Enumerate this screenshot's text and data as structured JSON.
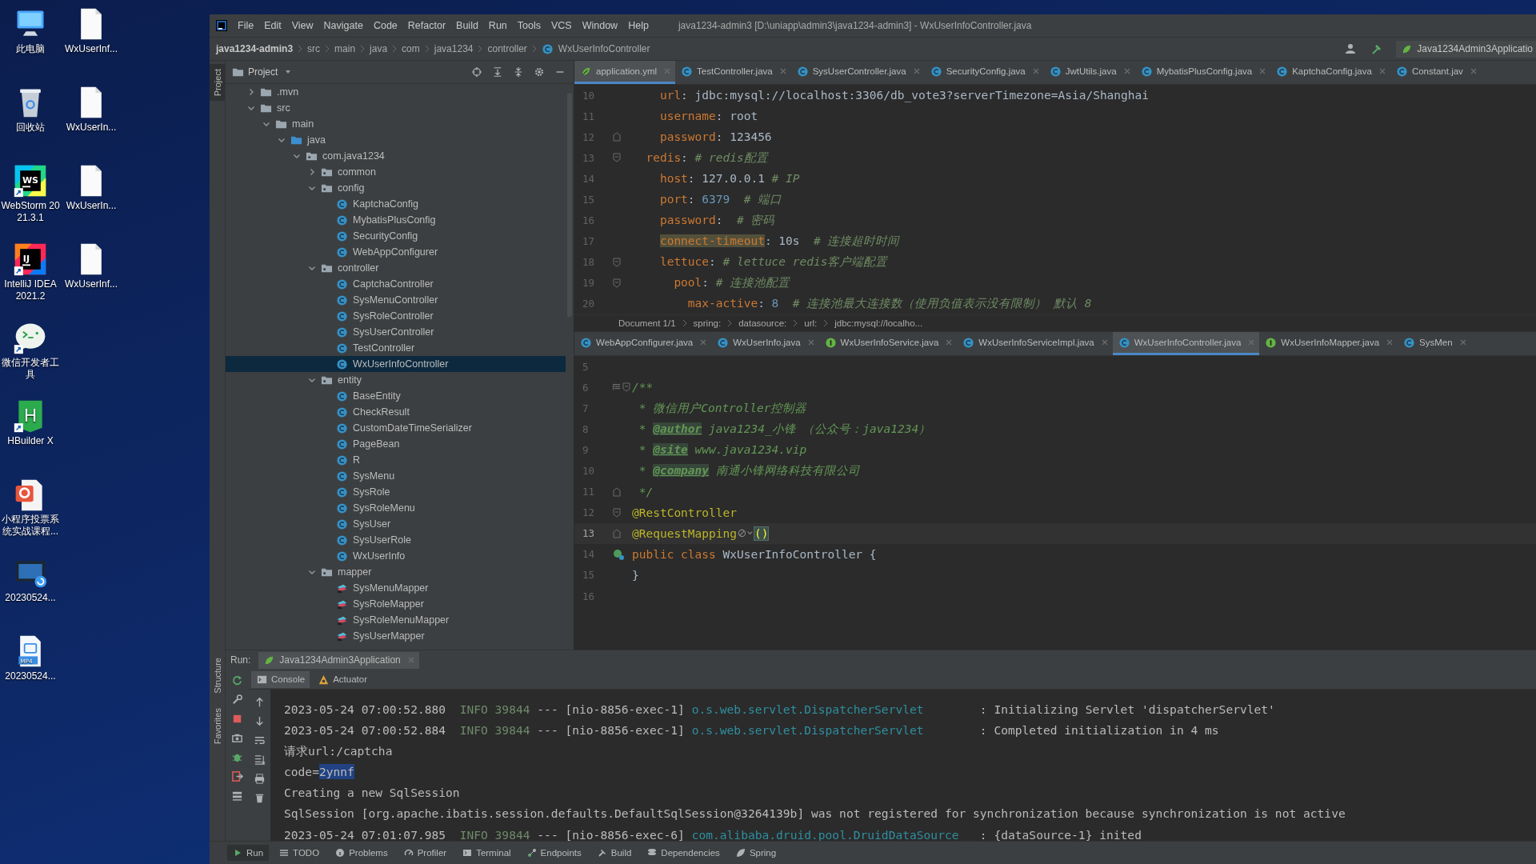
{
  "desktop": {
    "icon_columns": [
      {
        "icons": [
          {
            "label": "此电脑",
            "kind": "computer",
            "shortcut": false
          },
          {
            "label": "回收站",
            "kind": "recycle-bin",
            "shortcut": false
          },
          {
            "label": "WebStorm 2021.3.1",
            "kind": "webstorm",
            "badge": "WS",
            "shortcut": true
          },
          {
            "label": "IntelliJ IDEA 2021.2",
            "kind": "intellij",
            "badge": "IJ",
            "shortcut": true
          },
          {
            "label": "微信开发者工具",
            "kind": "wechat-devtool",
            "shortcut": true
          },
          {
            "label": "HBuilder X",
            "kind": "hbuilder",
            "badge": "H",
            "shortcut": true
          },
          {
            "label": "小程序投票系统实战课程...",
            "kind": "ppt",
            "shortcut": false
          },
          {
            "label": "20230524...",
            "kind": "video",
            "shortcut": false
          },
          {
            "label": "20230524...",
            "kind": "mp4",
            "badge": "MP4",
            "shortcut": false
          }
        ]
      },
      {
        "icons": [
          {
            "label": "WxUserInf...",
            "kind": "file",
            "shortcut": false
          },
          {
            "label": "WxUserIn...",
            "kind": "file",
            "shortcut": false
          },
          {
            "label": "WxUserIn...",
            "kind": "file",
            "shortcut": false
          },
          {
            "label": "WxUserInf...",
            "kind": "file",
            "shortcut": false
          }
        ]
      }
    ]
  },
  "ide": {
    "menu": [
      "File",
      "Edit",
      "View",
      "Navigate",
      "Code",
      "Refactor",
      "Build",
      "Run",
      "Tools",
      "VCS",
      "Window",
      "Help"
    ],
    "title": "java1234-admin3 [D:\\uniapp\\admin3\\java1234-admin3] - WxUserInfoController.java",
    "breadcrumb": [
      "java1234-admin3",
      "src",
      "main",
      "java",
      "com",
      "java1234",
      "controller",
      "WxUserInfoController"
    ],
    "run_config": "Java1234Admin3Applicatio",
    "project_strip": "Project",
    "project": {
      "title": "Project",
      "tree": [
        {
          "label": ".mvn",
          "kind": "folder",
          "expanded": false,
          "selected": false
        },
        {
          "label": "src",
          "kind": "folder",
          "expanded": true,
          "selected": false,
          "children": [
            {
              "label": "main",
              "kind": "folder",
              "expanded": true,
              "selected": false,
              "children": [
                {
                  "label": "java",
                  "kind": "source-folder",
                  "expanded": true,
                  "selected": false,
                  "children": [
                    {
                      "label": "com.java1234",
                      "kind": "package",
                      "expanded": true,
                      "selected": false,
                      "children": [
                        {
                          "label": "common",
                          "kind": "package",
                          "expanded": false,
                          "selected": false
                        },
                        {
                          "label": "config",
                          "kind": "package",
                          "expanded": true,
                          "selected": false,
                          "children": [
                            {
                              "label": "KaptchaConfig",
                              "kind": "class",
                              "selected": false
                            },
                            {
                              "label": "MybatisPlusConfig",
                              "kind": "class",
                              "selected": false
                            },
                            {
                              "label": "SecurityConfig",
                              "kind": "class",
                              "selected": false
                            },
                            {
                              "label": "WebAppConfigurer",
                              "kind": "class",
                              "selected": false
                            }
                          ]
                        },
                        {
                          "label": "controller",
                          "kind": "package",
                          "expanded": true,
                          "selected": false,
                          "children": [
                            {
                              "label": "CaptchaController",
                              "kind": "class",
                              "selected": false
                            },
                            {
                              "label": "SysMenuController",
                              "kind": "class",
                              "selected": false
                            },
                            {
                              "label": "SysRoleController",
                              "kind": "class",
                              "selected": false
                            },
                            {
                              "label": "SysUserController",
                              "kind": "class",
                              "selected": false
                            },
                            {
                              "label": "TestController",
                              "kind": "class",
                              "selected": false
                            },
                            {
                              "label": "WxUserInfoController",
                              "kind": "class",
                              "selected": true
                            }
                          ]
                        },
                        {
                          "label": "entity",
                          "kind": "package",
                          "expanded": true,
                          "selected": false,
                          "children": [
                            {
                              "label": "BaseEntity",
                              "kind": "class",
                              "selected": false
                            },
                            {
                              "label": "CheckResult",
                              "kind": "class",
                              "selected": false
                            },
                            {
                              "label": "CustomDateTimeSerializer",
                              "kind": "class",
                              "selected": false
                            },
                            {
                              "label": "PageBean",
                              "kind": "class",
                              "selected": false
                            },
                            {
                              "label": "R",
                              "kind": "class",
                              "selected": false
                            },
                            {
                              "label": "SysMenu",
                              "kind": "class",
                              "selected": false
                            },
                            {
                              "label": "SysRole",
                              "kind": "class",
                              "selected": false
                            },
                            {
                              "label": "SysRoleMenu",
                              "kind": "class",
                              "selected": false
                            },
                            {
                              "label": "SysUser",
                              "kind": "class",
                              "selected": false
                            },
                            {
                              "label": "SysUserRole",
                              "kind": "class",
                              "selected": false
                            },
                            {
                              "label": "WxUserInfo",
                              "kind": "class",
                              "selected": false
                            }
                          ]
                        },
                        {
                          "label": "mapper",
                          "kind": "package",
                          "expanded": true,
                          "selected": false,
                          "children": [
                            {
                              "label": "SysMenuMapper",
                              "kind": "mapper",
                              "selected": false
                            },
                            {
                              "label": "SysRoleMapper",
                              "kind": "mapper",
                              "selected": false
                            },
                            {
                              "label": "SysRoleMenuMapper",
                              "kind": "mapper",
                              "selected": false
                            },
                            {
                              "label": "SysUserMapper",
                              "kind": "mapper",
                              "selected": false
                            }
                          ]
                        }
                      ]
                    }
                  ]
                }
              ]
            }
          ]
        }
      ]
    },
    "top_editor": {
      "tabs": [
        {
          "label": "application.yml",
          "kind": "yaml",
          "selected": true
        },
        {
          "label": "TestController.java",
          "kind": "class",
          "selected": false
        },
        {
          "label": "SysUserController.java",
          "kind": "class",
          "selected": false
        },
        {
          "label": "SecurityConfig.java",
          "kind": "class",
          "selected": false
        },
        {
          "label": "JwtUtils.java",
          "kind": "class",
          "selected": false
        },
        {
          "label": "MybatisPlusConfig.java",
          "kind": "class",
          "selected": false
        },
        {
          "label": "KaptchaConfig.java",
          "kind": "class",
          "selected": false
        },
        {
          "label": "Constant.jav",
          "kind": "class",
          "selected": false
        }
      ],
      "lines": [
        {
          "number": "10",
          "kind": "plain",
          "tokens": [
            {
              "text": "    url",
              "kind": "key"
            },
            {
              "text": ": jdbc:mysql://localhost:3306/db_vote3?serverTimezone=Asia/Shanghai",
              "kind": "plain"
            }
          ]
        },
        {
          "number": "11",
          "kind": "plain",
          "tokens": [
            {
              "text": "    username",
              "kind": "key"
            },
            {
              "text": ": root",
              "kind": "plain"
            }
          ]
        },
        {
          "number": "12",
          "kind": "fold-end",
          "tokens": [
            {
              "text": "    password",
              "kind": "key"
            },
            {
              "text": ": 123456",
              "kind": "plain"
            }
          ]
        },
        {
          "number": "13",
          "kind": "fold-start",
          "tokens": [
            {
              "text": "  redis",
              "kind": "key"
            },
            {
              "text": ": ",
              "kind": "plain"
            },
            {
              "text": "# redis配置",
              "kind": "comment"
            }
          ]
        },
        {
          "number": "14",
          "kind": "plain",
          "tokens": [
            {
              "text": "    host",
              "kind": "key"
            },
            {
              "text": ": 127.0.0.1 ",
              "kind": "plain"
            },
            {
              "text": "# IP",
              "kind": "comment"
            }
          ]
        },
        {
          "number": "15",
          "kind": "plain",
          "tokens": [
            {
              "text": "    port",
              "kind": "key"
            },
            {
              "text": ": ",
              "kind": "plain"
            },
            {
              "text": "6379",
              "kind": "number"
            },
            {
              "text": "  # 端口",
              "kind": "comment"
            }
          ]
        },
        {
          "number": "16",
          "kind": "plain",
          "tokens": [
            {
              "text": "    password",
              "kind": "key"
            },
            {
              "text": ":  ",
              "kind": "plain"
            },
            {
              "text": "# 密码",
              "kind": "comment"
            }
          ]
        },
        {
          "number": "17",
          "kind": "plain",
          "tokens": [
            {
              "text": "    connect-timeout",
              "kind": "key-highlight"
            },
            {
              "text": ": 10s  ",
              "kind": "plain"
            },
            {
              "text": "# 连接超时时间",
              "kind": "comment"
            }
          ]
        },
        {
          "number": "18",
          "kind": "fold-start",
          "tokens": [
            {
              "text": "    lettuce",
              "kind": "key"
            },
            {
              "text": ": ",
              "kind": "plain"
            },
            {
              "text": "# lettuce redis客户端配置",
              "kind": "comment"
            }
          ]
        },
        {
          "number": "19",
          "kind": "fold-start",
          "tokens": [
            {
              "text": "      pool",
              "kind": "key"
            },
            {
              "text": ": ",
              "kind": "plain"
            },
            {
              "text": "# 连接池配置",
              "kind": "comment"
            }
          ]
        },
        {
          "number": "20",
          "kind": "plain",
          "tokens": [
            {
              "text": "        max-active",
              "kind": "key"
            },
            {
              "text": ": ",
              "kind": "plain"
            },
            {
              "text": "8",
              "kind": "number"
            },
            {
              "text": "  # 连接池最大连接数（使用负值表示没有限制） 默认 8",
              "kind": "comment"
            }
          ]
        }
      ],
      "breadcrumb": [
        "Document 1/1",
        "spring:",
        "datasource:",
        "url:",
        "jdbc:mysql://localho..."
      ]
    },
    "bottom_editor": {
      "tabs": [
        {
          "label": "WebAppConfigurer.java",
          "kind": "class",
          "selected": false
        },
        {
          "label": "WxUserInfo.java",
          "kind": "class",
          "selected": false
        },
        {
          "label": "WxUserInfoService.java",
          "kind": "interface",
          "selected": false
        },
        {
          "label": "WxUserInfoServiceImpl.java",
          "kind": "class",
          "selected": false
        },
        {
          "label": "WxUserInfoController.java",
          "kind": "class",
          "selected": true
        },
        {
          "label": "WxUserInfoMapper.java",
          "kind": "interface",
          "selected": false
        },
        {
          "label": "SysMen",
          "kind": "class",
          "selected": false
        }
      ],
      "lines": [
        {
          "number": "5",
          "current": false,
          "kind": "plain"
        },
        {
          "number": "6",
          "current": false,
          "kind": "doc-fold",
          "tokens": [
            {
              "text": "/**",
              "kind": "doc"
            }
          ]
        },
        {
          "number": "7",
          "current": false,
          "kind": "plain",
          "tokens": [
            {
              "text": " * 微信用户Controller控制器",
              "kind": "doc"
            }
          ]
        },
        {
          "number": "8",
          "current": false,
          "kind": "plain",
          "tokens": [
            {
              "text": " * ",
              "kind": "doc"
            },
            {
              "text": "@author",
              "kind": "doc-tag"
            },
            {
              "text": " java1234_小锋 （公众号：java1234）",
              "kind": "doc"
            }
          ]
        },
        {
          "number": "9",
          "current": false,
          "kind": "plain",
          "tokens": [
            {
              "text": " * ",
              "kind": "doc"
            },
            {
              "text": "@site",
              "kind": "doc-tag"
            },
            {
              "text": " www.java1234.vip",
              "kind": "doc"
            }
          ]
        },
        {
          "number": "10",
          "current": false,
          "kind": "plain",
          "tokens": [
            {
              "text": " * ",
              "kind": "doc"
            },
            {
              "text": "@company",
              "kind": "doc-tag"
            },
            {
              "text": " 南通小锋网络科技有限公司",
              "kind": "doc"
            }
          ]
        },
        {
          "number": "11",
          "current": false,
          "kind": "fold-end",
          "tokens": [
            {
              "text": " */",
              "kind": "doc"
            }
          ]
        },
        {
          "number": "12",
          "current": false,
          "kind": "fold-start",
          "tokens": [
            {
              "text": "@RestController",
              "kind": "annotation"
            }
          ]
        },
        {
          "number": "13",
          "current": true,
          "kind": "fold-end",
          "tokens": [
            {
              "text": "@RequestMapping",
              "kind": "annotation"
            },
            {
              "kind": "inlay"
            },
            {
              "text": "()",
              "kind": "brace-match"
            }
          ]
        },
        {
          "number": "14",
          "current": false,
          "kind": "bean",
          "tokens": [
            {
              "text": "public class ",
              "kind": "keyword"
            },
            {
              "text": "WxUserInfoController {",
              "kind": "plain"
            }
          ]
        },
        {
          "number": "15",
          "current": false,
          "kind": "plain",
          "tokens": [
            {
              "text": "}",
              "kind": "plain"
            }
          ]
        },
        {
          "number": "16",
          "current": false,
          "kind": "plain"
        }
      ]
    },
    "run": {
      "label": "Run:",
      "tab": "Java1234Admin3Application",
      "console_tabs": [
        {
          "label": "Console",
          "selected": true
        },
        {
          "label": "Actuator",
          "selected": false
        }
      ],
      "lines": [
        [
          {
            "text": "2023-05-24 07:00:52.880  ",
            "kind": "text"
          },
          {
            "text": "INFO 39844",
            "kind": "level"
          },
          {
            "text": " --- [nio-8856-exec-1] ",
            "kind": "text"
          },
          {
            "text": "o.s.web.servlet.DispatcherServlet",
            "kind": "logger"
          },
          {
            "text": "        : Initializing Servlet 'dispatcherServlet'",
            "kind": "text"
          }
        ],
        [
          {
            "text": "2023-05-24 07:00:52.884  ",
            "kind": "text"
          },
          {
            "text": "INFO 39844",
            "kind": "level"
          },
          {
            "text": " --- [nio-8856-exec-1] ",
            "kind": "text"
          },
          {
            "text": "o.s.web.servlet.DispatcherServlet",
            "kind": "logger"
          },
          {
            "text": "        : Completed initialization in 4 ms",
            "kind": "text"
          }
        ],
        [
          {
            "text": "请求url:/captcha",
            "kind": "text"
          }
        ],
        [
          {
            "text": "code=",
            "kind": "text"
          },
          {
            "text": "2ynnf",
            "kind": "selected"
          }
        ],
        [
          {
            "text": "Creating a new SqlSession",
            "kind": "text"
          }
        ],
        [
          {
            "text": "SqlSession [org.apache.ibatis.session.defaults.DefaultSqlSession@3264139b] was not registered for synchronization because synchronization is not active",
            "kind": "text"
          }
        ],
        [
          {
            "text": "2023-05-24 07:01:07.985  ",
            "kind": "text"
          },
          {
            "text": "INFO 39844",
            "kind": "level"
          },
          {
            "text": " --- [nio-8856-exec-6] ",
            "kind": "text"
          },
          {
            "text": "com.alibaba.druid.pool.DruidDataSource",
            "kind": "logger"
          },
          {
            "text": "   : {dataSource-1} inited",
            "kind": "text"
          }
        ]
      ]
    },
    "side_labels": [
      "Structure",
      "Favorites"
    ],
    "tool_strip": [
      {
        "label": "Run",
        "selected": true
      },
      {
        "label": "TODO",
        "selected": false
      },
      {
        "label": "Problems",
        "selected": false
      },
      {
        "label": "Profiler",
        "selected": false
      },
      {
        "label": "Terminal",
        "selected": false
      },
      {
        "label": "Endpoints",
        "selected": false
      },
      {
        "label": "Build",
        "selected": false
      },
      {
        "label": "Dependencies",
        "selected": false
      },
      {
        "label": "Spring",
        "selected": false
      }
    ]
  }
}
